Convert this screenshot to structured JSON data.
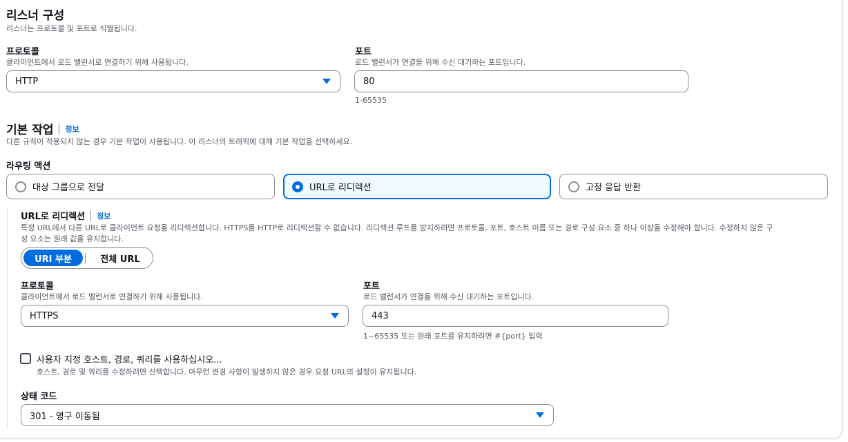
{
  "listener": {
    "title": "리스너 구성",
    "description": "리스너는 프로토콜 및 포트로 식별됩니다.",
    "protocol_label": "프로토콜",
    "protocol_desc": "클라이언트에서 로드 밸런서로 연결하기 위해 사용됩니다.",
    "protocol_value": "HTTP",
    "port_label": "포트",
    "port_desc": "로드 밸런서가 연결을 위해 수신 대기하는 포트입니다.",
    "port_value": "80",
    "port_hint": "1-65535"
  },
  "default_action": {
    "title": "기본 작업",
    "info": "정보",
    "description": "다른 규칙이 적용되지 않는 경우 기본 작업이 사용됩니다. 이 리스너의 트래픽에 대해 기본 작업을 선택하세요.",
    "routing_label": "라우팅 액션",
    "options": [
      "대상 그룹으로 전달",
      "URL로 리디렉션",
      "고정 응답 반환"
    ],
    "selected_index": 1
  },
  "redirect": {
    "title": "URL로 리디렉션",
    "info": "정보",
    "description_line1": "특정 URL에서 다른 URL로 클라이언트 요청을 리디렉션합니다. HTTPS를 HTTP로 리디렉션할 수 없습니다. 리디렉션 루프를 방지하려면 프로토콜, 포트, 호스트 이름 또는 경로 구성 요소 중 하나 이상을 수정해야 합니다. 수정하지 않은 구",
    "description_line2": "성 요소는 원래 값을 유지합니다.",
    "segment_selected": "URI 부분",
    "segment_other": "전체 URL",
    "protocol_label": "프로토콜",
    "protocol_desc": "클라이언트에서 로드 밸런서로 연결하기 위해 사용됩니다.",
    "protocol_value": "HTTPS",
    "port_label": "포트",
    "port_desc": "로드 밸런서가 연결을 위해 수신 대기하는 포트입니다.",
    "port_value": "443",
    "port_hint": "1~65535 또는 원래 포트를 유지하려면 #{port} 입력",
    "custom_label": "사용자 지정 호스트, 경로, 쿼리를 사용하십시오...",
    "custom_desc": "호스트, 경로 및 쿼리를 수정하려면 선택합니다. 아무런 변경 사항이 발생하지 않은 경우 요청 URL의 설정이 유지됩니다.",
    "custom_checked": false,
    "status_label": "상태 코드",
    "status_value": "301 - 영구 이동됨"
  },
  "colors": {
    "accent": "#006ce0",
    "border": "#8c8c94",
    "selected_bg": "#f0fbff"
  }
}
